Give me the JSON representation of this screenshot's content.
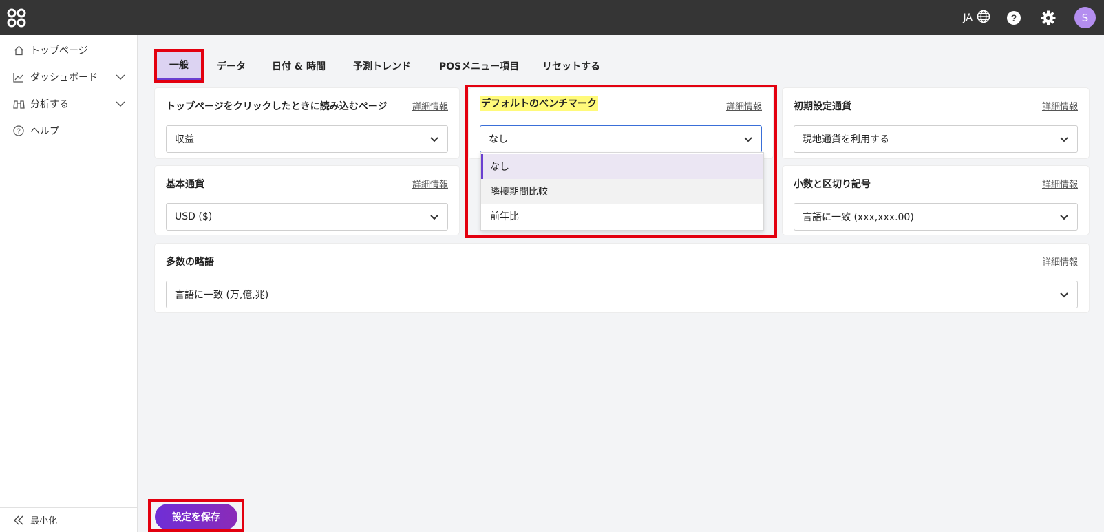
{
  "header": {
    "language": "JA",
    "avatar_initial": "S",
    "icons": [
      "app-logo-icon",
      "globe-icon",
      "help-icon",
      "gear-icon"
    ],
    "bg_color": "#353535"
  },
  "sidebar": {
    "items": [
      {
        "label": "トップページ",
        "icon": "home-icon"
      },
      {
        "label": "ダッシュボード",
        "icon": "chart-icon"
      },
      {
        "label": "分析する",
        "icon": "binoculars-icon"
      },
      {
        "label": "ヘルプ",
        "icon": "question-icon"
      }
    ],
    "minimize_label": "最小化"
  },
  "tabs": [
    "一般",
    "データ",
    "日付 & 時間",
    "予測トレンド",
    "POSメニュー項目",
    "リセットする"
  ],
  "active_tab": "一般",
  "cards": {
    "landing_page": {
      "title": "トップページをクリックしたときに読み込むページ",
      "link": "詳細情報",
      "value": "収益"
    },
    "benchmark": {
      "title": "デフォルトのベンチマーク",
      "link": "詳細情報",
      "value": "なし"
    },
    "default_currency": {
      "title": "初期設定通貨",
      "link": "詳細情報",
      "value": "現地通貨を利用する"
    },
    "base_currency": {
      "title": "基本通貨",
      "link": "詳細情報",
      "value": "USD ($)"
    },
    "decimal": {
      "title": "小数と区切り記号",
      "link": "詳細情報",
      "value": "言語に一致 (xxx,xxx.00)"
    },
    "abbreviation": {
      "title": "多数の略語",
      "link": "詳細情報",
      "value": "言語に一致 (万,億,兆)"
    }
  },
  "benchmark_options": [
    "なし",
    "隣接期間比較",
    "前年比"
  ],
  "save_label": "設定を保存",
  "colors": {
    "accent": "#6a3fd0",
    "highlight_frame": "#e3000f",
    "title_highlight": "#fffa7a"
  }
}
